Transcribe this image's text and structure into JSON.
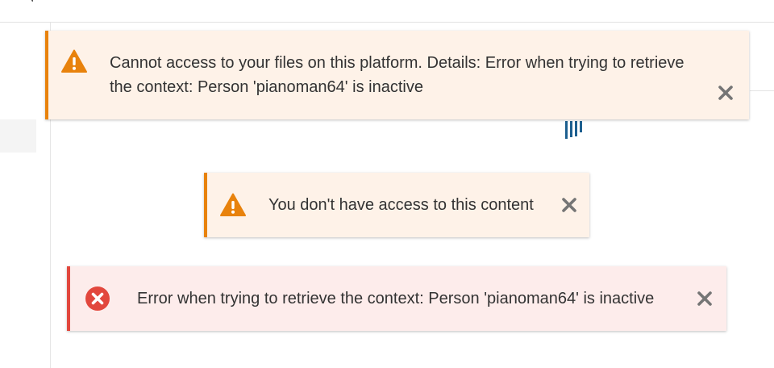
{
  "icons": {
    "warning": "warning-triangle-icon",
    "error": "error-circle-x-icon",
    "close": "close-icon"
  },
  "colors": {
    "warning_accent": "#e8820c",
    "warning_bg": "#fef2e8",
    "error_accent": "#e2473d",
    "error_bg": "#fdeceb",
    "close_icon": "#757575",
    "brand_bars": "#1d5f8f"
  },
  "notifications": [
    {
      "type": "warning",
      "message": "Cannot access to your files on this platform. Details: Error when trying to retrieve the context: Person 'pianoman64' is inactive"
    },
    {
      "type": "warning",
      "message": "You don't have access to this content"
    },
    {
      "type": "error",
      "message": "Error when trying to retrieve the context: Person 'pianoman64' is inactive"
    }
  ]
}
